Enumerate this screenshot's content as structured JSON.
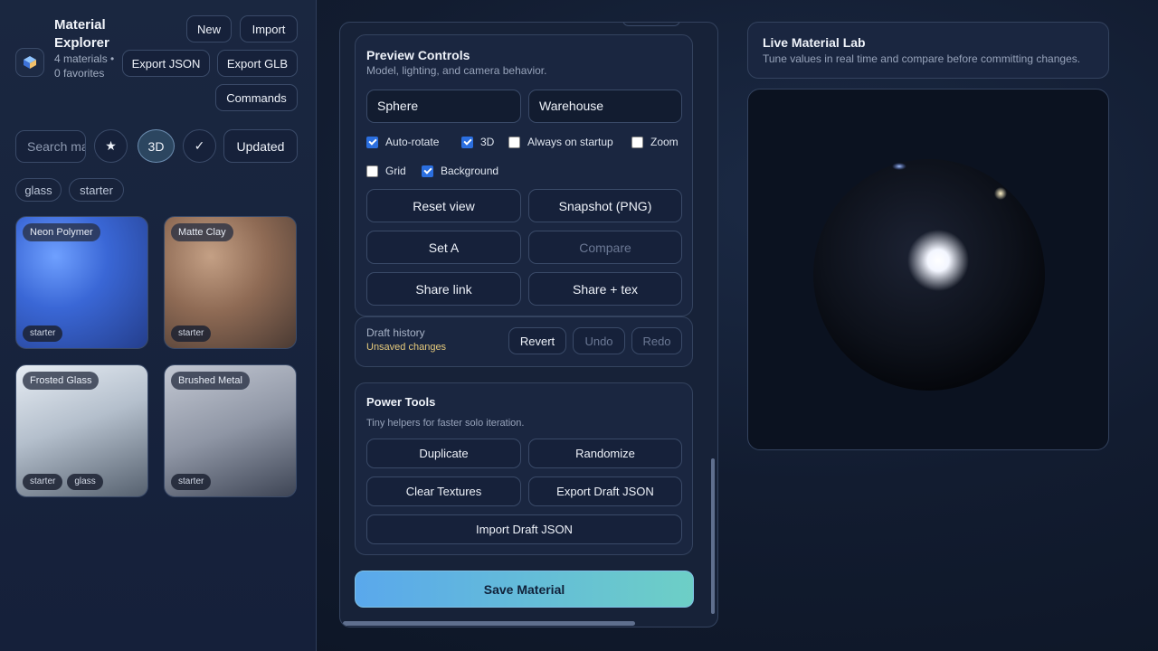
{
  "sidebar": {
    "title": "Material Explorer",
    "meta": "4 materials • 0 favorites",
    "buttons": {
      "new": "New",
      "import": "Import",
      "export_json": "Export JSON",
      "export_glb": "Export GLB",
      "commands": "Commands"
    },
    "search_placeholder": "Search materials",
    "filters": {
      "favorites": "★",
      "three_d": "3D",
      "check": "✓",
      "sort": "Updated"
    },
    "tags": [
      "glass",
      "starter"
    ],
    "cards": [
      {
        "name": "Neon Polymer",
        "chips": [
          "starter"
        ]
      },
      {
        "name": "Matte Clay",
        "chips": [
          "starter"
        ]
      },
      {
        "name": "Frosted Glass",
        "chips": [
          "starter",
          "glass"
        ]
      },
      {
        "name": "Brushed Metal",
        "chips": [
          "starter"
        ]
      }
    ]
  },
  "preview_controls": {
    "title": "Preview Controls",
    "subtitle": "Model, lighting, and camera behavior.",
    "model": "Sphere",
    "environment": "Warehouse",
    "checkboxes": [
      {
        "label": "Auto-rotate",
        "checked": true
      },
      {
        "label": "3D",
        "checked": true
      },
      {
        "label": "Always on startup",
        "checked": false
      },
      {
        "label": "Zoom",
        "checked": false
      },
      {
        "label": "Grid",
        "checked": false
      },
      {
        "label": "Background",
        "checked": true
      }
    ],
    "buttons": {
      "reset_view": "Reset view",
      "snapshot": "Snapshot (PNG)",
      "set_a": "Set A",
      "compare": "Compare",
      "share_link": "Share link",
      "share_tex": "Share + tex"
    }
  },
  "draft": {
    "label": "Draft history",
    "status": "Unsaved changes",
    "revert": "Revert",
    "undo": "Undo",
    "redo": "Redo"
  },
  "power_tools": {
    "title": "Power Tools",
    "subtitle": "Tiny helpers for faster solo iteration.",
    "duplicate": "Duplicate",
    "randomize": "Randomize",
    "clear_textures": "Clear Textures",
    "export_draft": "Export Draft JSON",
    "import_draft": "Import Draft JSON"
  },
  "save_label": "Save Material",
  "lab": {
    "title": "Live Material Lab",
    "subtitle": "Tune values in real time and compare before committing changes."
  },
  "colors": {
    "accent_start": "#5aa8ec",
    "accent_end": "#6dcfc6",
    "checkbox": "#2b6fe0"
  }
}
